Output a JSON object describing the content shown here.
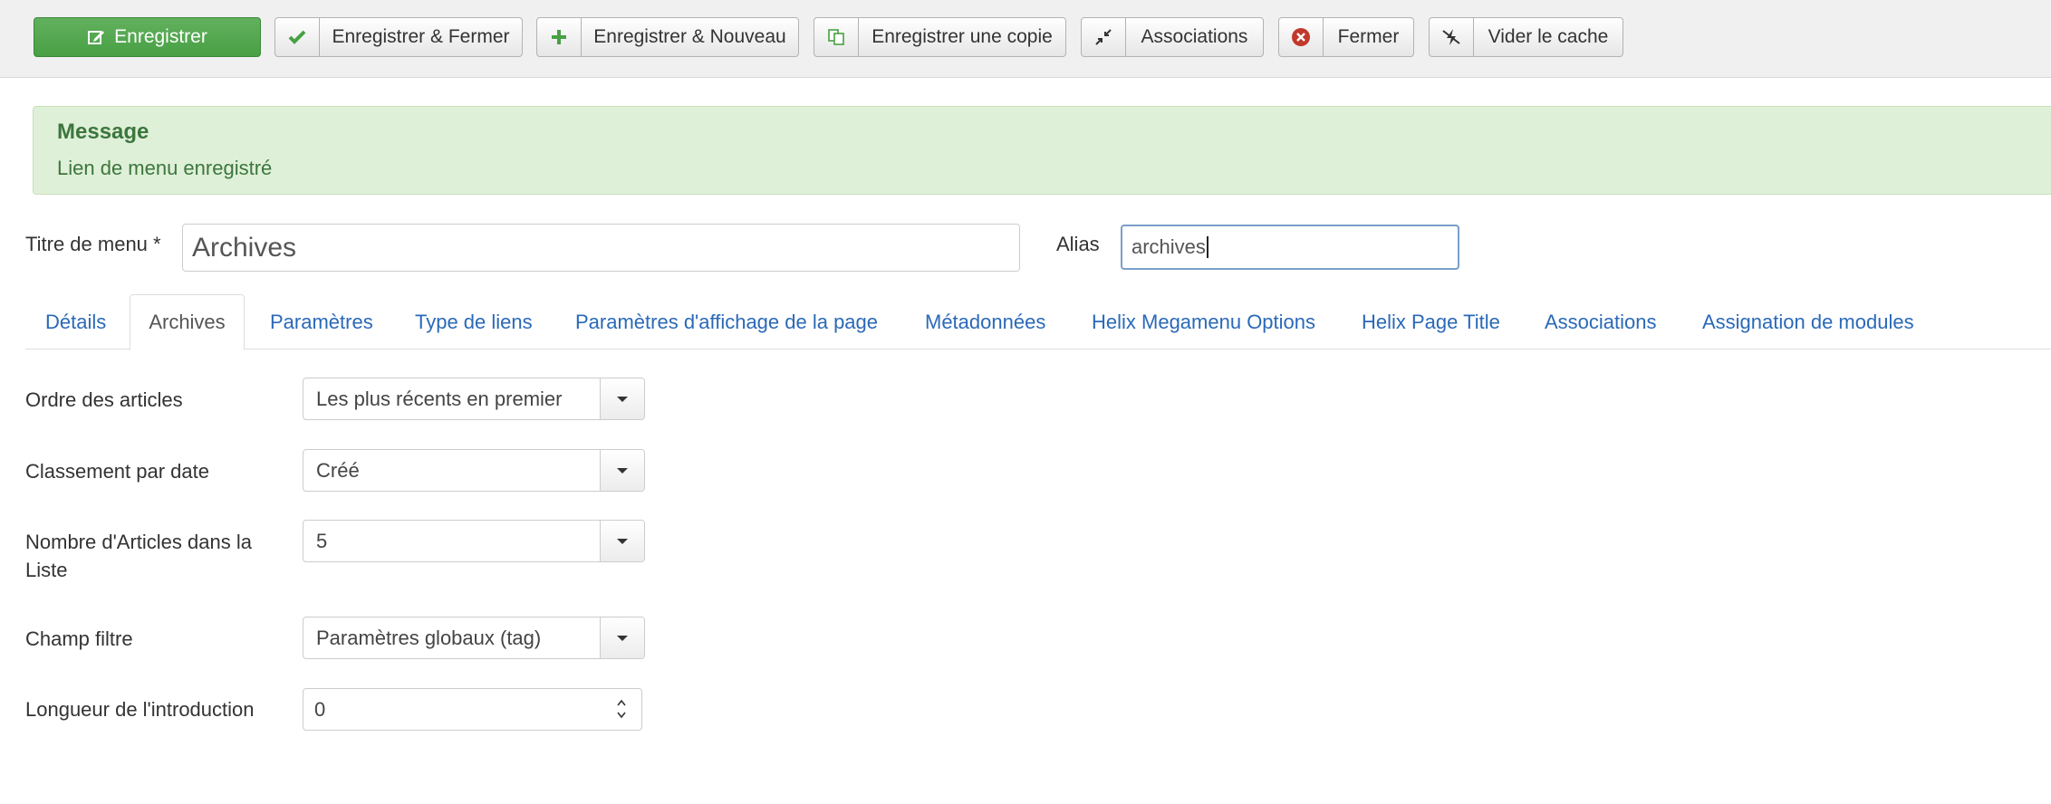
{
  "toolbar": {
    "save": "Enregistrer",
    "save_close": "Enregistrer & Fermer",
    "save_new": "Enregistrer & Nouveau",
    "save_copy": "Enregistrer une copie",
    "associations": "Associations",
    "close": "Fermer",
    "clear_cache": "Vider le cache",
    "icons": {
      "save": "edit-icon",
      "save_close": "check-icon",
      "save_new": "plus-icon",
      "save_copy": "copy-icon",
      "associations": "contract-icon",
      "close": "cancel-circle-icon",
      "clear_cache": "lightning-off-icon"
    },
    "colors": {
      "primary": "#48a044",
      "close_icon": "#c0392b"
    }
  },
  "message": {
    "heading": "Message",
    "text": "Lien de menu enregistré",
    "color": "#3c763d",
    "background": "#dff0d8"
  },
  "title_field": {
    "label": "Titre de menu *",
    "value": "Archives"
  },
  "alias_field": {
    "label": "Alias",
    "value": "archives"
  },
  "tabs": [
    {
      "label": "Détails",
      "active": false
    },
    {
      "label": "Archives",
      "active": true
    },
    {
      "label": "Paramètres",
      "active": false
    },
    {
      "label": "Type de liens",
      "active": false
    },
    {
      "label": "Paramètres d'affichage de la page",
      "active": false
    },
    {
      "label": "Métadonnées",
      "active": false
    },
    {
      "label": "Helix Megamenu Options",
      "active": false
    },
    {
      "label": "Helix Page Title",
      "active": false
    },
    {
      "label": "Associations",
      "active": false
    },
    {
      "label": "Assignation de modules",
      "active": false
    }
  ],
  "fields": [
    {
      "label": "Ordre des articles",
      "value": "Les plus récents en premier",
      "type": "select"
    },
    {
      "label": "Classement par date",
      "value": "Créé",
      "type": "select"
    },
    {
      "label": "Nombre d'Articles dans la Liste",
      "value": "5",
      "type": "select"
    },
    {
      "label": "Champ filtre",
      "value": "Paramètres globaux (tag)",
      "type": "select"
    },
    {
      "label": "Longueur de l'introduction",
      "value": "0",
      "type": "number"
    }
  ],
  "link_color": "#2a69b8"
}
